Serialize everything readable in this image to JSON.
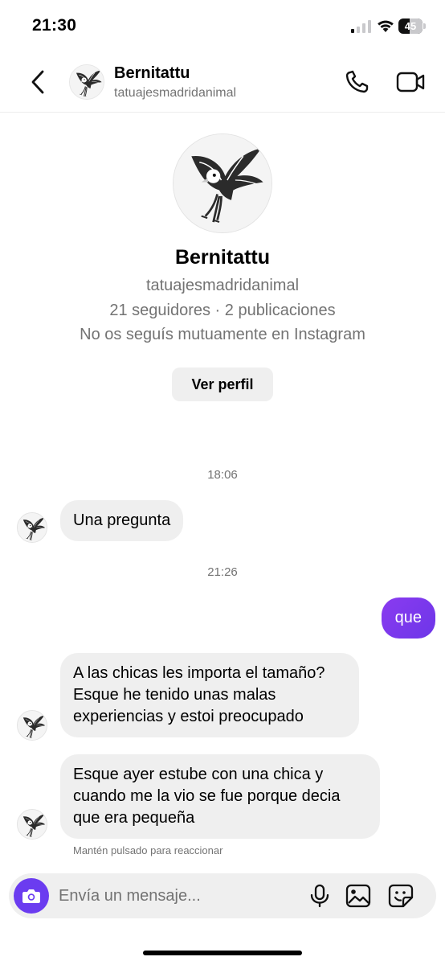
{
  "status_bar": {
    "time": "21:30",
    "battery_level": "45",
    "battery_fraction": 0.45
  },
  "header": {
    "name": "Bernitattu",
    "username": "tatuajesmadridanimal",
    "icons": [
      "back-chevron-icon",
      "eagle-avatar",
      "phone-icon",
      "video-camera-icon"
    ]
  },
  "profile": {
    "name": "Bernitattu",
    "username": "tatuajesmadridanimal",
    "stats": "21 seguidores · 2 publicaciones",
    "mutual": "No os seguís mutuamente en Instagram",
    "view_profile_label": "Ver perfil"
  },
  "conversation": {
    "timestamps": [
      "18:06",
      "21:26"
    ],
    "messages": [
      {
        "from": "them",
        "text": "Una pregunta"
      },
      {
        "from": "me",
        "text": "que"
      },
      {
        "from": "them",
        "text": "A las chicas les importa el tamaño? Esque he tenido unas malas experiencias y estoi preocupado"
      },
      {
        "from": "them",
        "text": "Esque ayer estube con una chica y cuando me la vio se fue porque decia que era pequeña"
      }
    ],
    "reaction_hint": "Mantén pulsado para reaccionar"
  },
  "composer": {
    "placeholder": "Envía un mensaje...",
    "icons": [
      "camera-icon",
      "microphone-icon",
      "gallery-icon",
      "sticker-icon"
    ]
  },
  "colors": {
    "accent": "#7c3aed",
    "bubble_in": "#efefef",
    "secondary_text": "#737373"
  }
}
